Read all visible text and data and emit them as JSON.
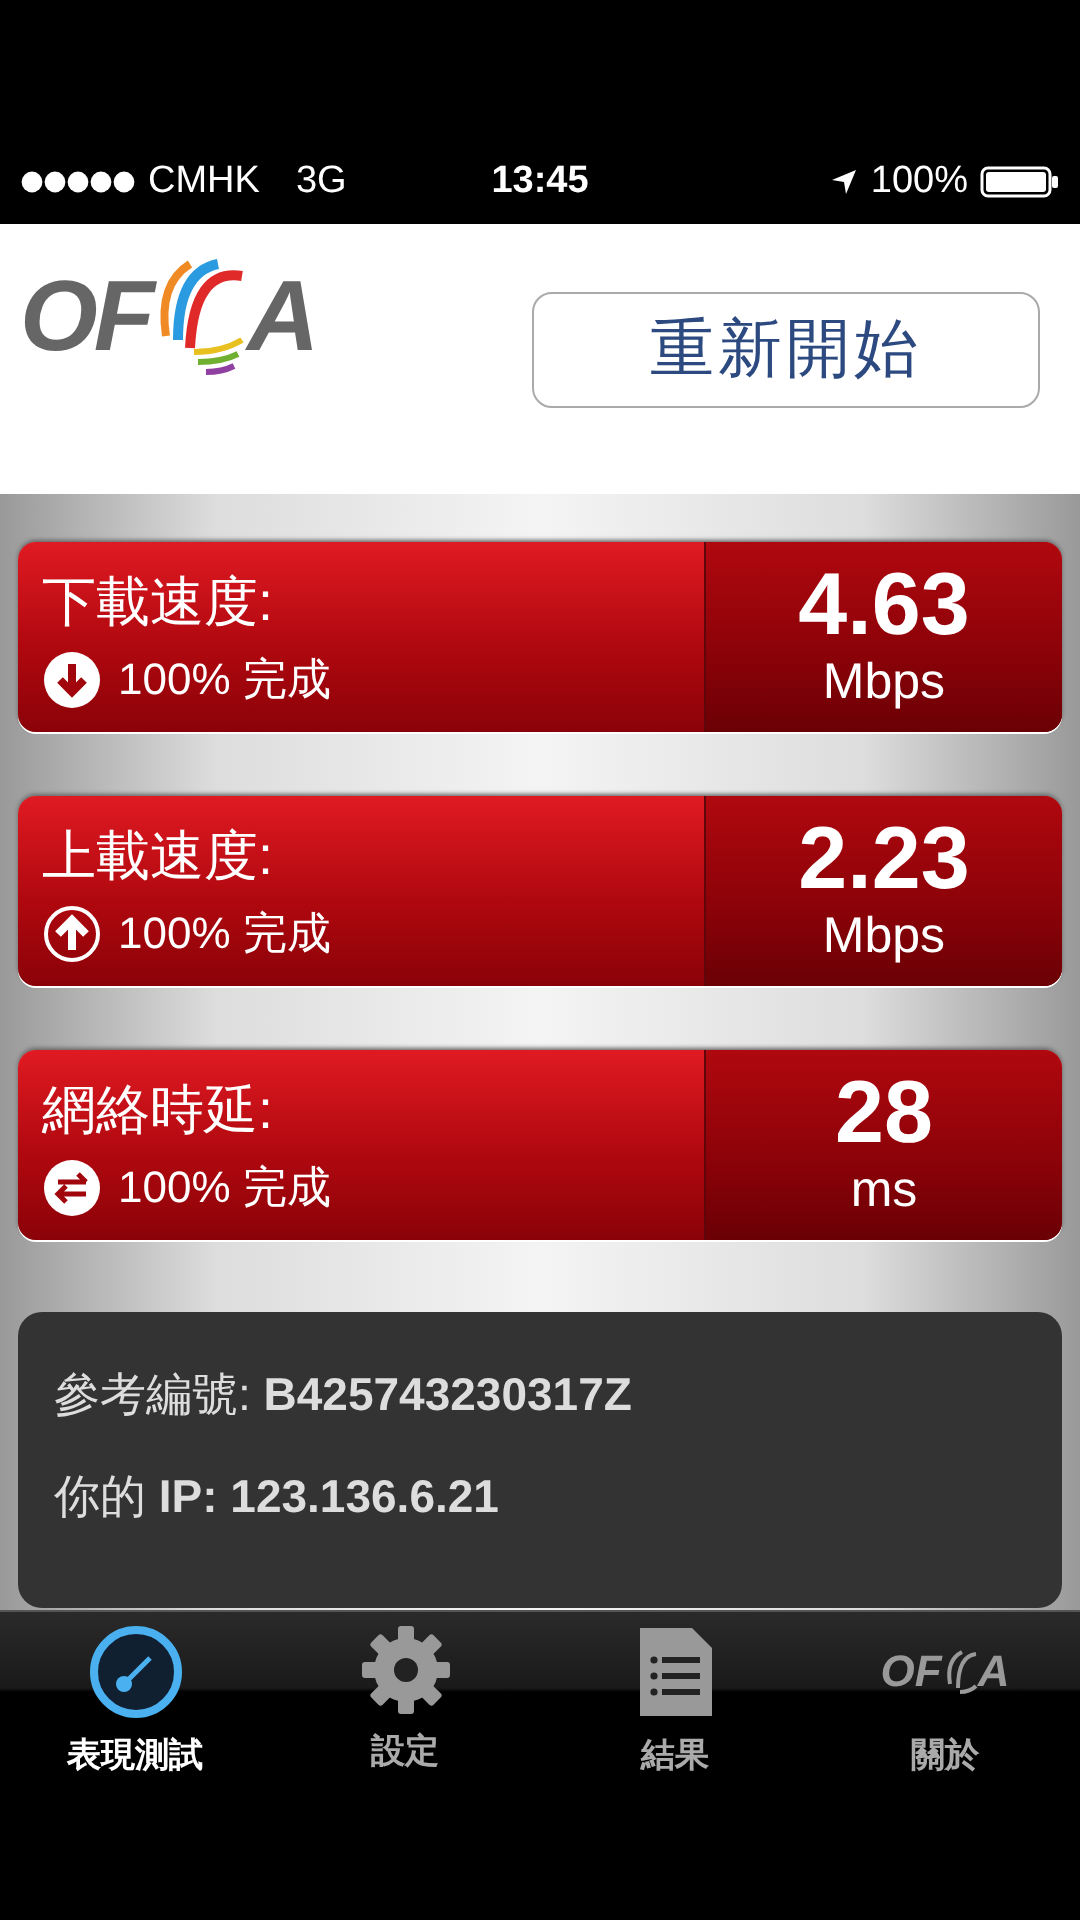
{
  "status_bar": {
    "carrier": "CMHK",
    "network": "3G",
    "time": "13:45",
    "battery": "100%"
  },
  "header": {
    "logo": {
      "left": "OF",
      "right": "A"
    },
    "restart_button": "重新開始"
  },
  "metrics": [
    {
      "kind": "down",
      "title": "下載速度:",
      "progress": "100% 完成",
      "value": "4.63",
      "unit": "Mbps"
    },
    {
      "kind": "up",
      "title": "上載速度:",
      "progress": "100% 完成",
      "value": "2.23",
      "unit": "Mbps"
    },
    {
      "kind": "swap",
      "title": "網絡時延:",
      "progress": "100% 完成",
      "value": "28",
      "unit": "ms"
    }
  ],
  "info": [
    "參考編號: **B425743230317Z**",
    "你的 **IP: 123.136.6.21**"
  ],
  "tabs": [
    {
      "kind": "gauge",
      "label": "表現測試",
      "selected": true
    },
    {
      "kind": "gear",
      "label": "設定",
      "selected": false
    },
    {
      "kind": "document",
      "label": "結果",
      "selected": false
    },
    {
      "kind": "logo",
      "label": "關於",
      "selected": false,
      "logo": {
        "left": "OF",
        "right": "A"
      }
    }
  ]
}
